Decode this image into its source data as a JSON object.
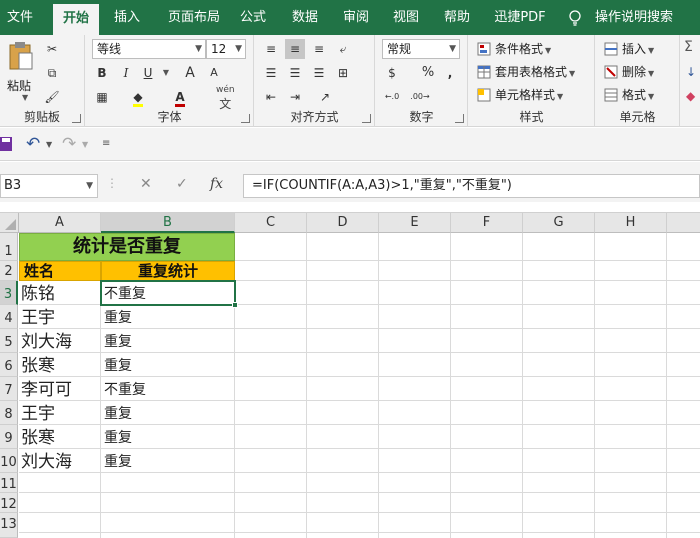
{
  "ribbon_tabs": [
    "文件",
    "开始",
    "插入",
    "页面布局",
    "公式",
    "数据",
    "审阅",
    "视图",
    "帮助",
    "迅捷PDF"
  ],
  "tell_me": "操作说明搜索",
  "clipboard": {
    "paste": "粘贴",
    "label": "剪贴板"
  },
  "font": {
    "name": "等线",
    "size": "12",
    "label": "字体",
    "bold": "B",
    "italic": "I",
    "underline": "U",
    "grow": "A",
    "shrink": "A",
    "color_letter": "A",
    "wen": "wén",
    "wen_char": "文"
  },
  "alignment": {
    "label": "对齐方式"
  },
  "number": {
    "format": "常规",
    "label": "数字",
    "currency": "$",
    "percent": "%",
    "comma": ","
  },
  "styles": {
    "conditional": "条件格式",
    "table": "套用表格格式",
    "cell": "单元格样式",
    "label": "样式"
  },
  "cells": {
    "insert": "插入",
    "delete": "删除",
    "format": "格式",
    "label": "单元格"
  },
  "formula_bar": {
    "name_box": "B3",
    "fx": "fx",
    "formula": "=IF(COUNTIF(A:A,A3)>1,\"重复\",\"不重复\")"
  },
  "columns": [
    "A",
    "B",
    "C",
    "D",
    "E",
    "F",
    "G",
    "H"
  ],
  "rows": [
    "1",
    "2",
    "3",
    "4",
    "5",
    "6",
    "7",
    "8",
    "9",
    "10",
    "11",
    "12",
    "13"
  ],
  "sheet": {
    "title": "统计是否重复",
    "header_name": "姓名",
    "header_stat": "重复统计",
    "names": [
      "陈铭",
      "王宇",
      "刘大海",
      "张寒",
      "李可可",
      "王宇",
      "张寒",
      "刘大海"
    ],
    "results": [
      "不重复",
      "重复",
      "重复",
      "重复",
      "不重复",
      "重复",
      "重复",
      "重复"
    ]
  },
  "colors": {
    "accent": "#217346",
    "title_fill": "#92d050",
    "header_fill": "#ffc000"
  }
}
